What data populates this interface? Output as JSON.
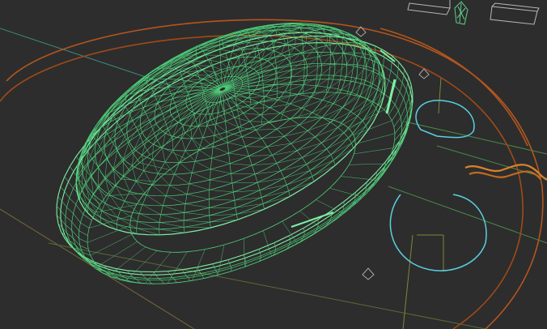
{
  "viewport": {
    "kind": "3d-wireframe-perspective-view",
    "background": "#2d2d2d",
    "colors": {
      "wireframe": "#4ecf7a",
      "wireframe_bright": "#7ff0a4",
      "orange_curve": "#b4561e",
      "orange_path": "#d9822b",
      "cyan_curve": "#5ad0e0",
      "teal_line": "#3a8a7a",
      "olive_line": "#7a7a3a",
      "grey_outline": "#a8a8a8"
    },
    "objects": [
      {
        "name": "stadium-dome",
        "type": "wireframe-mesh"
      },
      {
        "name": "outer-orange-ring",
        "type": "spline"
      },
      {
        "name": "cyan-shapes",
        "type": "spline"
      },
      {
        "name": "orange-path",
        "type": "spline"
      },
      {
        "name": "camera-markers",
        "type": "helper"
      },
      {
        "name": "small-boxes",
        "type": "wireframe-box"
      }
    ]
  }
}
